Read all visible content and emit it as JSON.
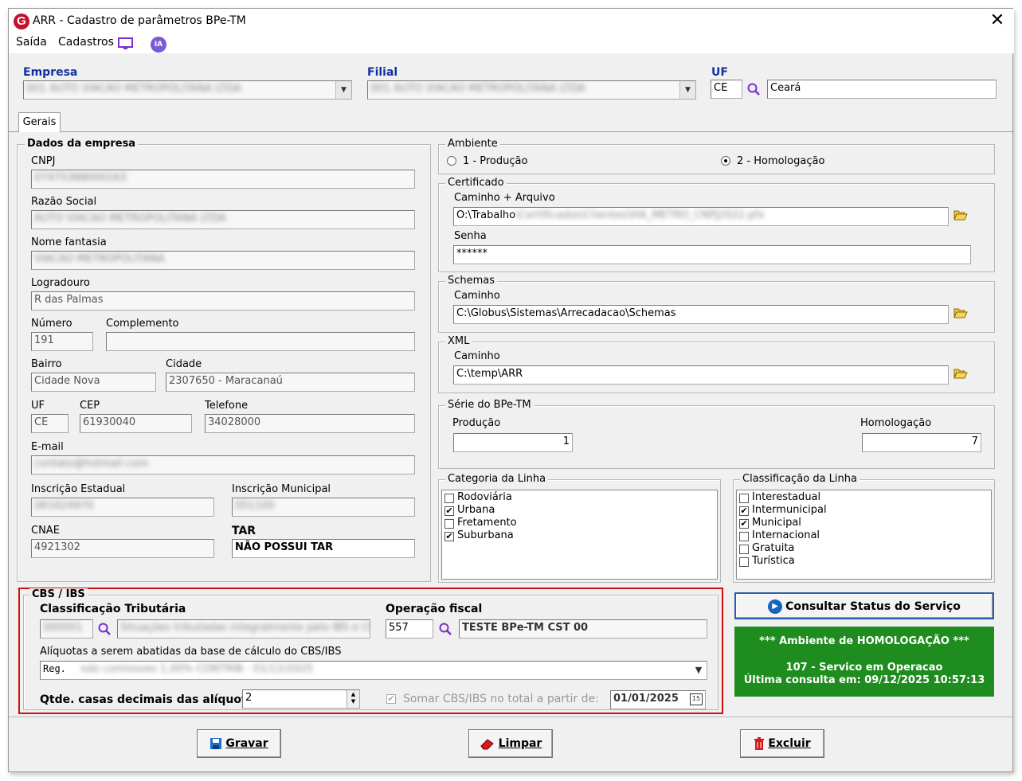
{
  "window": {
    "title": "ARR - Cadastro de parâmetros BPe-TM",
    "app_icon": "G"
  },
  "menu": {
    "items": [
      "Saída",
      "Cadastros"
    ],
    "ia_label": "IA"
  },
  "header": {
    "empresa_label": "Empresa",
    "empresa_value": "001 AUTO VIACAO METROPOLITANA LTDA",
    "filial_label": "Filial",
    "filial_value": "001 AUTO VIACAO METROPOLITANA LTDA",
    "uf_label": "UF",
    "uf_value": "CE",
    "uf_name": "Ceará"
  },
  "tabs": [
    "Gerais"
  ],
  "dados_empresa": {
    "title": "Dados da empresa",
    "cnpj_label": "CNPJ",
    "cnpj_value": "07475388000163",
    "razao_label": "Razão Social",
    "razao_value": "AUTO VIACAO METROPOLITANA LTDA",
    "fantasia_label": "Nome fantasia",
    "fantasia_value": "VIACAO METROPOLITANA",
    "logradouro_label": "Logradouro",
    "logradouro_value": "R das Palmas",
    "numero_label": "Número",
    "numero_value": "191",
    "complemento_label": "Complemento",
    "complemento_value": "",
    "bairro_label": "Bairro",
    "bairro_value": "Cidade Nova",
    "cidade_label": "Cidade",
    "cidade_value": "2307650 - Maracanaú",
    "uf_label": "UF",
    "uf_value": "CE",
    "cep_label": "CEP",
    "cep_value": "61930040",
    "telefone_label": "Telefone",
    "telefone_value": "34028000",
    "email_label": "E-mail",
    "email_value": "contato@hotmail.com",
    "ie_label": "Inscrição Estadual",
    "ie_value": "061624970",
    "im_label": "Inscrição Municipal",
    "im_value": "051100",
    "cnae_label": "CNAE",
    "cnae_value": "4921302",
    "tar_label": "TAR",
    "tar_value": "NÃO POSSUI TAR"
  },
  "ambiente": {
    "title": "Ambiente",
    "opt1": "1 - Produção",
    "opt2": "2 - Homologação",
    "selected": "2"
  },
  "certificado": {
    "title": "Certificado",
    "path_label": "Caminho + Arquivo",
    "path_value": "O:\\Trabalho",
    "path_hidden": "\\Certificados\\Clientes\\VIA_METRO_CNPJ2022.pfx",
    "senha_label": "Senha",
    "senha_value": "******"
  },
  "schemas": {
    "title": "Schemas",
    "path_label": "Caminho",
    "path_value": "C:\\Globus\\Sistemas\\Arrecadacao\\Schemas"
  },
  "xml": {
    "title": "XML",
    "path_label": "Caminho",
    "path_value": "C:\\temp\\ARR"
  },
  "serie": {
    "title": "Série do BPe-TM",
    "producao_label": "Produção",
    "producao_value": "1",
    "homologacao_label": "Homologação",
    "homologacao_value": "7"
  },
  "categoria": {
    "title": "Categoria da Linha",
    "items": [
      {
        "label": "Rodoviária",
        "checked": false
      },
      {
        "label": "Urbana",
        "checked": true
      },
      {
        "label": "Fretamento",
        "checked": false
      },
      {
        "label": "Suburbana",
        "checked": true
      }
    ]
  },
  "classificacao": {
    "title": "Classificação da Linha",
    "items": [
      {
        "label": "Interestadual",
        "checked": false
      },
      {
        "label": "Intermunicipal",
        "checked": true
      },
      {
        "label": "Municipal",
        "checked": true
      },
      {
        "label": "Internacional",
        "checked": false
      },
      {
        "label": "Gratuita",
        "checked": false
      },
      {
        "label": "Turística",
        "checked": false
      }
    ]
  },
  "cbs": {
    "title": "CBS / IBS",
    "class_label": "Classificação Tributária",
    "class_code": "000001",
    "class_desc": "Situações tributadas integralmente pelo IBS e CBS",
    "op_label": "Operação fiscal",
    "op_code": "557",
    "op_desc": "TESTE BPe-TM CST 00",
    "aliq_label": "Alíquotas a serem abatidas da base de cálculo do CBS/IBS",
    "aliq_prefix": "Reg.",
    "aliq_hidden": "xdo comissoes 1,00% CONTRIB - 01/12/2025",
    "qtde_label": "Qtde. casas decimais das alíquotas",
    "qtde_value": "2",
    "somar_label": "Somar CBS/IBS no total a partir de:",
    "somar_date": "01/01/2025"
  },
  "status": {
    "button_label": "Consultar Status do Serviço",
    "line1": "*** Ambiente de HOMOLOGAÇÃO ***",
    "line2": "107 - Servico em Operacao",
    "line3": "Última consulta em: 09/12/2025 10:57:13",
    "bg_color": "#1e8c1e"
  },
  "actions": {
    "gravar": "Gravar",
    "limpar": "Limpar",
    "excluir": "Excluir"
  }
}
